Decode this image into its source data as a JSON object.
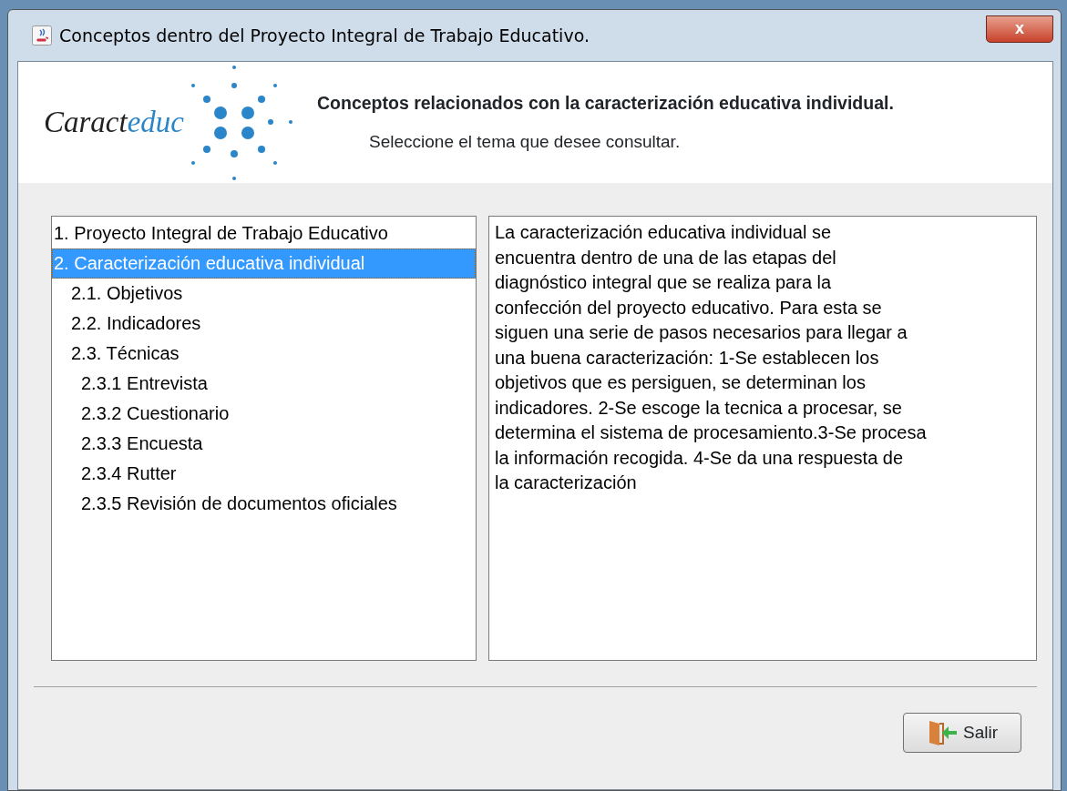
{
  "window": {
    "title": "Conceptos dentro del Proyecto Integral de Trabajo Educativo.",
    "close": "x"
  },
  "header": {
    "logo_text": "Caract",
    "logo_accent": "educ",
    "title": "Conceptos relacionados con la caracterización educativa individual.",
    "subtitle": "Seleccione el tema que desee consultar."
  },
  "topics": [
    {
      "label": "1. Proyecto Integral de Trabajo Educativo",
      "selected": false
    },
    {
      "label": "2. Caracterización educativa individual",
      "selected": true,
      "children": [
        {
          "label": "2.1. Objetivos",
          "selected": false
        },
        {
          "label": "2.2. Indicadores",
          "selected": false
        },
        {
          "label": "2.3. Técnicas",
          "selected": false,
          "children": [
            {
              "label": "2.3.1 Entrevista",
              "selected": false
            },
            {
              "label": "2.3.2 Cuestionario",
              "selected": false
            },
            {
              "label": "2.3.3 Encuesta",
              "selected": false
            },
            {
              "label": "2.3.4 Rutter",
              "selected": false
            },
            {
              "label": "2.3.5 Revisión de documentos oficiales",
              "selected": false
            }
          ]
        }
      ]
    }
  ],
  "description": [
    "La caracterización educativa individual se",
    "encuentra dentro de una de las etapas del",
    "diagnóstico integral que se realiza para la",
    "confección del proyecto educativo. Para esta se",
    "siguen una serie de pasos necesarios para llegar a",
    "una buena caracterización: 1-Se establecen los",
    "objetivos que es persiguen, se determinan los",
    "indicadores. 2-Se escoge la tecnica a procesar, se",
    "determina el sistema de procesamiento.3-Se procesa",
    "la información recogida. 4-Se da una respuesta de",
    "la caracterización"
  ],
  "buttons": [
    {
      "label": "Salir"
    }
  ]
}
